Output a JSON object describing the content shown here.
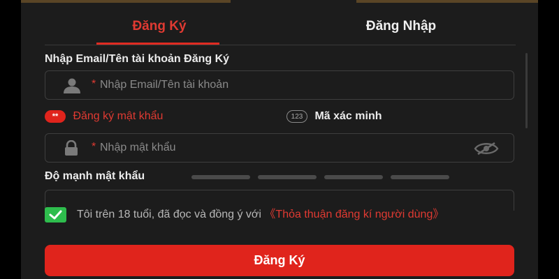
{
  "tabs": {
    "register": "Đăng Ký",
    "login": "Đăng Nhập"
  },
  "email_section": {
    "label": "Nhập Email/Tên tài khoản Đăng Ký",
    "required_mark": "*",
    "placeholder": "Nhập Email/Tên tài khoản"
  },
  "password_options": {
    "password_icon_text": "**",
    "password_label": "Đăng ký mật khẩu",
    "code_icon_text": "123",
    "code_label": "Mã xác minh"
  },
  "password_field": {
    "required_mark": "*",
    "placeholder": "Nhập mật khẩu"
  },
  "strength": {
    "label": "Độ mạnh mật khẩu",
    "level": 0,
    "segments": 4
  },
  "terms": {
    "checked": true,
    "text": "Tôi trên 18 tuổi, đã đọc và đồng ý với ",
    "link": "《Thỏa thuận đăng kí người dùng》"
  },
  "submit_label": "Đăng Ký",
  "colors": {
    "accent": "#e0241c",
    "background": "#1c1c1c",
    "checkbox": "#2ebd4d"
  }
}
